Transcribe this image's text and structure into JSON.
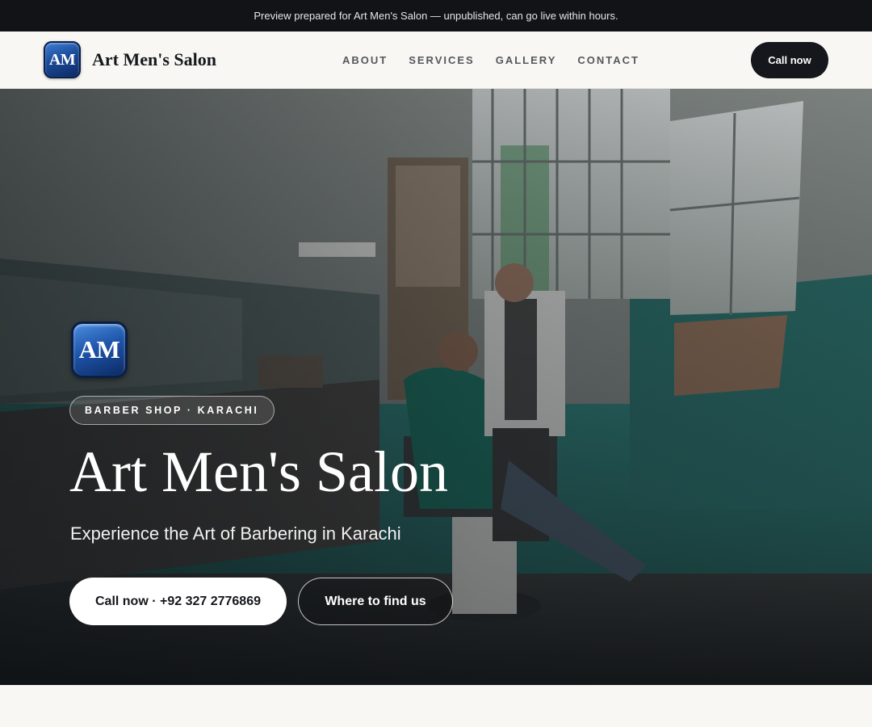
{
  "preview_banner": {
    "text": "Preview prepared for Art Men's Salon — unpublished, can go live within hours."
  },
  "brand": {
    "logo_text": "AM",
    "name": "Art Men's Salon"
  },
  "nav": {
    "links": [
      "ABOUT",
      "SERVICES",
      "GALLERY",
      "CONTACT"
    ],
    "call_label": "Call now"
  },
  "hero": {
    "background_image": "barbershop-photo",
    "logo_text": "AM",
    "tag": "BARBER SHOP · KARACHI",
    "title": "Art Men's Salon",
    "subtitle": "Experience the Art of Barbering in Karachi",
    "primary_button": "Call now · +92 327 2776869",
    "secondary_button": "Where to find us"
  },
  "colors": {
    "dark": "#15171c",
    "logo_blue": "#1c4b9a",
    "page_bg": "#f8f7f4"
  }
}
